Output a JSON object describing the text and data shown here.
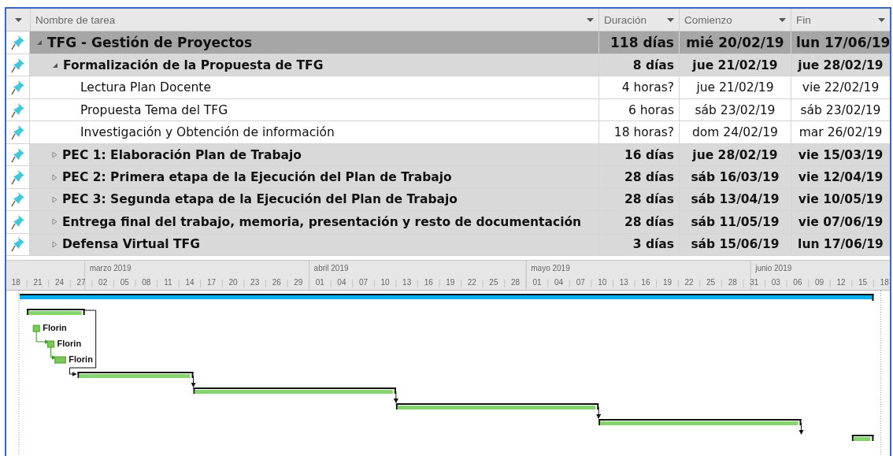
{
  "columns": [
    {
      "label": "Nombre de tarea"
    },
    {
      "label": "Duración"
    },
    {
      "label": "Comienzo"
    },
    {
      "label": "Fin"
    }
  ],
  "tasks": [
    {
      "kind": "project",
      "name": "TFG - Gestión de Proyectos",
      "duration": "118 días",
      "start": "mié 20/02/19",
      "end": "lun 17/06/19",
      "expanded": true,
      "children": [
        {
          "kind": "summary",
          "name": "Formalización de la Propuesta de TFG",
          "duration": "8 días",
          "start": "jue 21/02/19",
          "end": "jue 28/02/19",
          "expanded": true,
          "children": [
            {
              "kind": "task",
              "name": "Lectura Plan Docente",
              "duration": "4 horas?",
              "start": "jue 21/02/19",
              "end": "vie 22/02/19",
              "resource": "Florin"
            },
            {
              "kind": "task",
              "name": "Propuesta Tema del TFG",
              "duration": "6 horas",
              "start": "sáb 23/02/19",
              "end": "sáb 23/02/19",
              "resource": "Florin"
            },
            {
              "kind": "task",
              "name": "Investigación y Obtención de información",
              "duration": "18 horas?",
              "start": "dom 24/02/19",
              "end": "mar 26/02/19",
              "resource": "Florin"
            }
          ]
        },
        {
          "kind": "summary",
          "name": "PEC 1: Elaboración Plan de Trabajo",
          "duration": "16 días",
          "start": "jue 28/02/19",
          "end": "vie 15/03/19",
          "expanded": false
        },
        {
          "kind": "summary",
          "name": "PEC 2: Primera etapa de la Ejecución del Plan de Trabajo",
          "duration": "28 días",
          "start": "sáb 16/03/19",
          "end": "vie 12/04/19",
          "expanded": false
        },
        {
          "kind": "summary",
          "name": "PEC 3: Segunda etapa de la Ejecución del Plan de Trabajo",
          "duration": "28 días",
          "start": "sáb 13/04/19",
          "end": "vie 10/05/19",
          "expanded": false
        },
        {
          "kind": "summary",
          "name": "Entrega final del trabajo, memoria, presentación y resto de documentación",
          "duration": "28 días",
          "start": "sáb 11/05/19",
          "end": "vie 07/06/19",
          "expanded": false
        },
        {
          "kind": "summary",
          "name": "Defensa Virtual TFG",
          "duration": "3 días",
          "start": "sáb 15/06/19",
          "end": "lun 17/06/19",
          "expanded": false
        }
      ]
    }
  ],
  "timescale": {
    "months": [
      "marzo 2019",
      "abril 2019",
      "mayo 2019",
      "junio 2019"
    ],
    "days": [
      "18",
      "21",
      "24",
      "27",
      "02",
      "05",
      "08",
      "11",
      "14",
      "17",
      "20",
      "23",
      "26",
      "29",
      "01",
      "04",
      "07",
      "10",
      "13",
      "16",
      "19",
      "22",
      "25",
      "28",
      "01",
      "04",
      "07",
      "10",
      "13",
      "16",
      "19",
      "22",
      "25",
      "28",
      "31",
      "03",
      "06",
      "09",
      "12",
      "15",
      "18"
    ]
  }
}
